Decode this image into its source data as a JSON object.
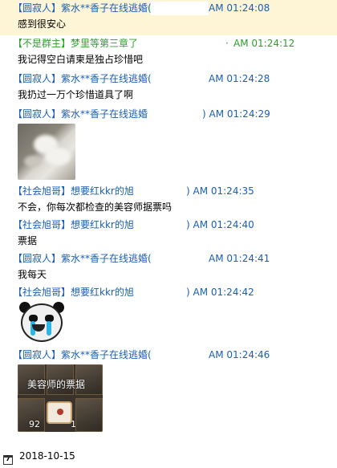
{
  "messages": [
    {
      "sender": "【圆寂人】紫水**香子在线逃婚(",
      "time": "AM 01:24:08",
      "text": "感到很安心"
    },
    {
      "sender": "【不是群主】梦里等第三章了",
      "time": "AM 01:24:12",
      "time_prefix": "·",
      "text": "我记得空白请柬是独占珍惜吧"
    },
    {
      "sender": "【圆寂人】紫水**香子在线逃婚(",
      "time": "AM 01:24:28",
      "text": "我扔过一万个珍惜道具了啊"
    },
    {
      "sender": "【圆寂人】紫水**香子在线逃婚",
      "time": ") AM 01:24:29",
      "image": "blurry-cat-photo"
    },
    {
      "sender": "【社会旭哥】想要红kkr的旭",
      "time": ") AM 01:24:35",
      "text": "不会，你每次都检查的美容师据票吗"
    },
    {
      "sender": "【社会旭哥】想要红kkr的旭",
      "time": ") AM 01:24:40",
      "text": "票据"
    },
    {
      "sender": "【圆寂人】紫水**香子在线逃婚(",
      "time": "AM 01:24:41",
      "text": "我每天"
    },
    {
      "sender": "【社会旭哥】想要红kkr的旭",
      "time": ") AM 01:24:42",
      "image": "crying-panda-sticker"
    },
    {
      "sender": "【圆寂人】紫水**香子在线逃婚(",
      "time": "AM 01:24:46",
      "image": "inventory-screenshot"
    }
  ],
  "inventory": {
    "caption": "美容师的票据",
    "count_left": "92",
    "count_right": "1"
  },
  "footer": {
    "date": "2018-10-15",
    "calendar_glyph": "7"
  },
  "colors": {
    "name_blue": "#1a5fb4",
    "name_green": "#2e9e2e",
    "highlight_bg": "#fdf5d6"
  }
}
